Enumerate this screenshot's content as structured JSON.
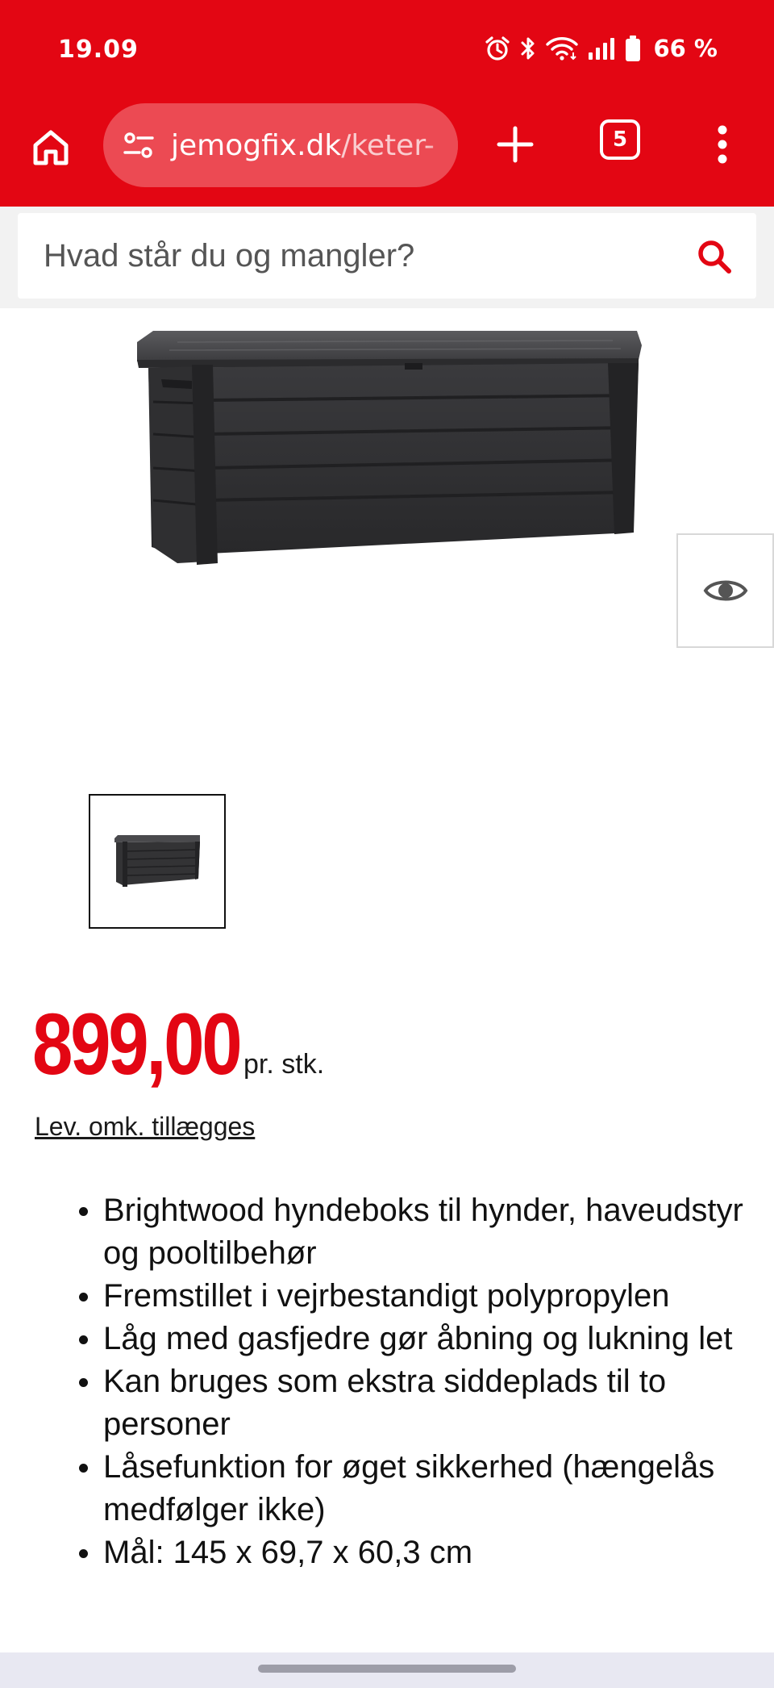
{
  "status_bar": {
    "time": "19.09",
    "battery": "66 %",
    "icons": [
      "alarm-icon",
      "bluetooth-icon",
      "wifi-icon",
      "signal-icon",
      "battery-icon"
    ]
  },
  "browser": {
    "url_host": "jemogfix.dk",
    "url_path": "/keter-",
    "tab_count": "5",
    "accent_color": "#e30613"
  },
  "search": {
    "placeholder": "Hvad står du og mangler?"
  },
  "product": {
    "image_alt": "Keter Brightwood hyndeboks antracit",
    "price": "899,00",
    "price_unit": "pr. stk.",
    "shipping_note": "Lev. omk. tillægges",
    "features": [
      "Brightwood hyndeboks til hynder, haveudstyr og pooltilbehør",
      "Fremstillet i vejrbestandigt polypropylen",
      "Låg med gasfjedre gør åbning og lukning let",
      "Kan bruges som ekstra siddeplads til to personer",
      "Låsefunktion for øget sikkerhed (hængelås medfølger ikke)",
      "Mål: 145 x 69,7 x 60,3 cm"
    ]
  }
}
